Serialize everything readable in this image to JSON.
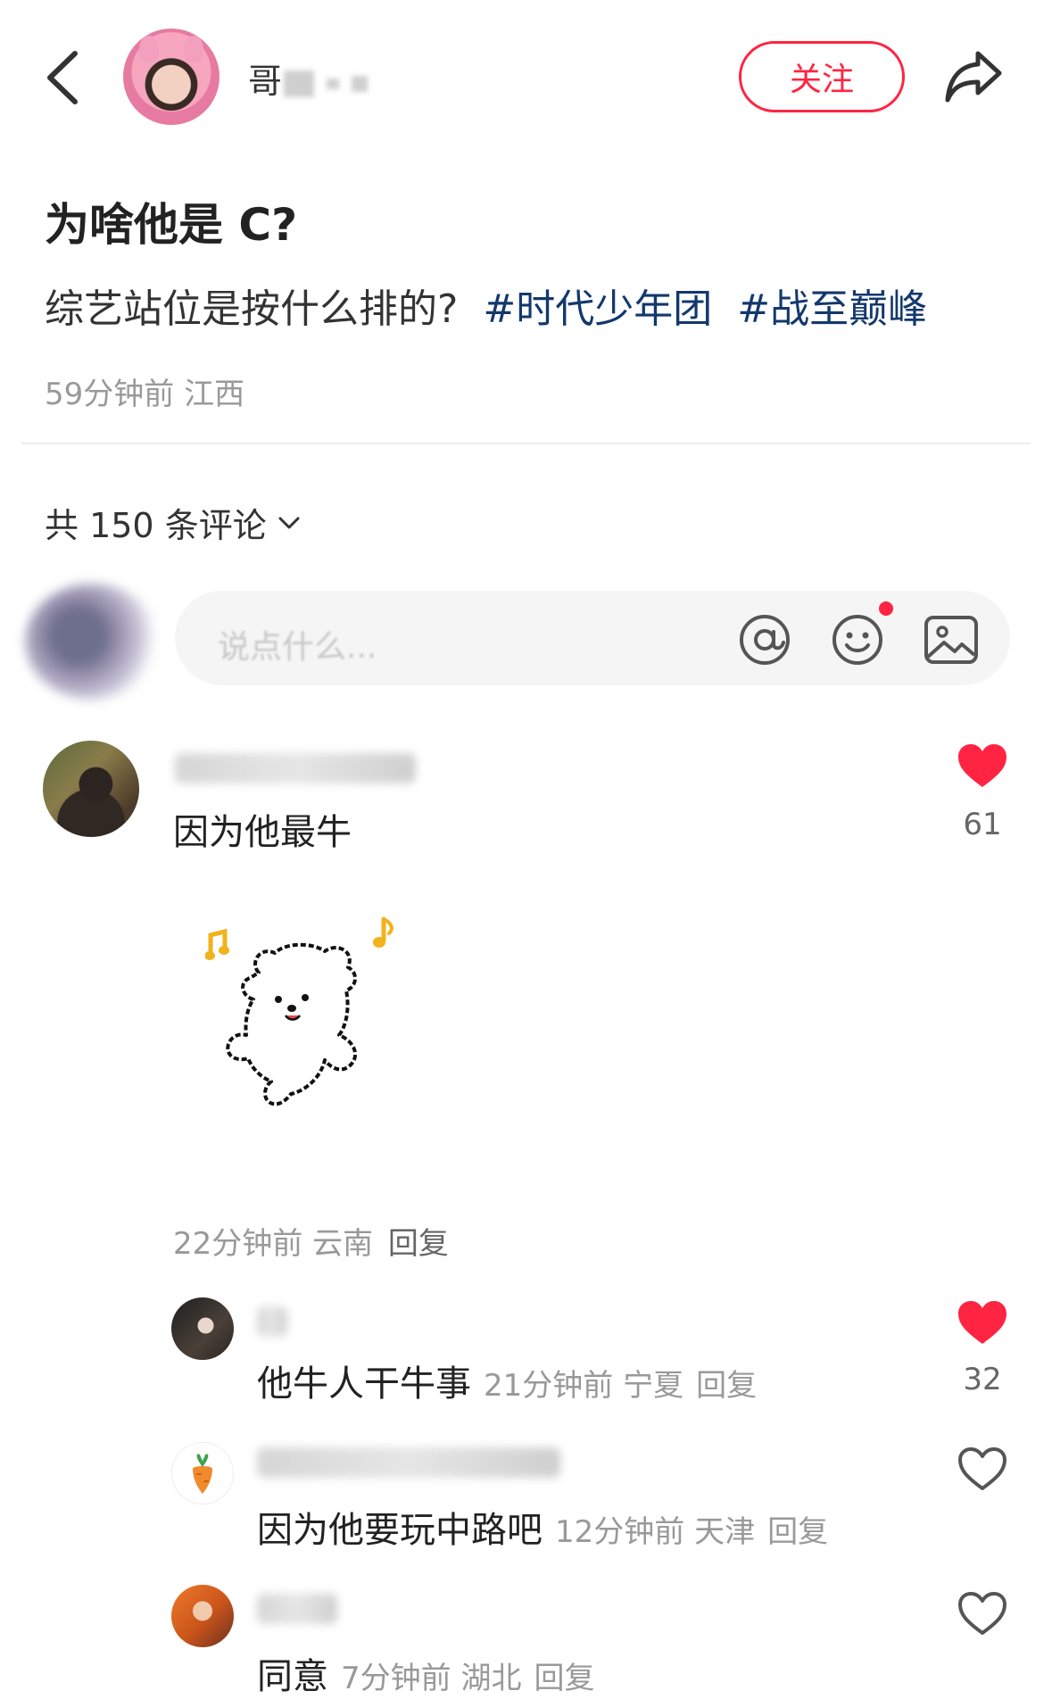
{
  "header": {
    "author_name_visible": "哥",
    "follow_label": "关注"
  },
  "post": {
    "title": "为啥他是 C?",
    "body": "综艺站位是按什么排的?",
    "hashtags": [
      "#时代少年团",
      "#战至巅峰"
    ],
    "meta": "59分钟前 江西"
  },
  "comments_header": {
    "count_label": "共 150 条评论"
  },
  "comment_input": {
    "placeholder": "说点什么..."
  },
  "comments": [
    {
      "text": "因为他最牛",
      "likes": "61",
      "liked": true,
      "meta": "22分钟前 云南",
      "reply_label": "回复",
      "replies": [
        {
          "text": "他牛人干牛事",
          "meta": "21分钟前 宁夏",
          "reply_label": "回复",
          "likes": "32",
          "liked": true
        },
        {
          "text": "因为他要玩中路吧",
          "meta": "12分钟前 天津",
          "reply_label": "回复",
          "liked": false
        },
        {
          "text": "同意",
          "meta": "7分钟前 湖北",
          "reply_label": "回复",
          "liked": false
        }
      ]
    }
  ],
  "colors": {
    "accent": "#ff2442",
    "hashtag": "#13386c",
    "meta": "#999999",
    "sticker_notes": "#f2b21b"
  },
  "icons": [
    "back-arrow-icon",
    "share-icon",
    "at-icon",
    "emoji-icon",
    "image-icon",
    "heart-icon",
    "chevron-down-icon"
  ]
}
